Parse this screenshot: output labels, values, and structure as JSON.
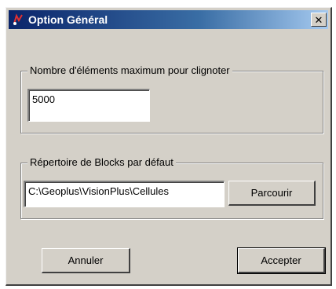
{
  "window": {
    "title": "Option Général",
    "close_glyph": "✕"
  },
  "max_elements": {
    "label": "Nombre d'éléments maximum pour clignoter",
    "value": "5000"
  },
  "blocks_dir": {
    "label": "Répertoire de Blocks par défaut",
    "value": "C:\\Geoplus\\VisionPlus\\Cellules",
    "browse_label": "Parcourir"
  },
  "actions": {
    "cancel_label": "Annuler",
    "accept_label": "Accepter"
  },
  "colors": {
    "titlebar_start": "#0a246a",
    "titlebar_end": "#a6caf0",
    "window_bg": "#d4d0c8"
  },
  "icons": {
    "app": "app-icon",
    "close": "close-icon"
  }
}
